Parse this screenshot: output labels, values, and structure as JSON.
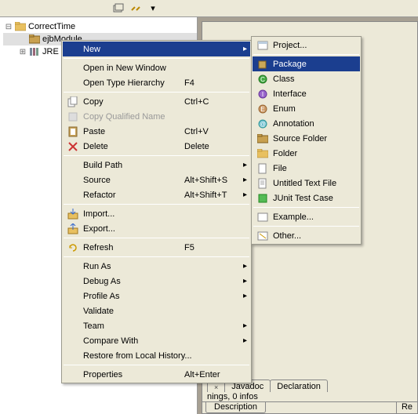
{
  "toolbar": {
    "icons": [
      "collapse-icon",
      "link-icon",
      "menu-icon"
    ]
  },
  "tree": {
    "root": "CorrectTime",
    "child1": "ejbModule",
    "child2": "JRE"
  },
  "context_menu": {
    "new": "New",
    "open_new_window": "Open in New Window",
    "open_type_hierarchy": "Open Type Hierarchy",
    "open_type_hierarchy_key": "F4",
    "copy": "Copy",
    "copy_key": "Ctrl+C",
    "copy_qualified": "Copy Qualified Name",
    "paste": "Paste",
    "paste_key": "Ctrl+V",
    "delete": "Delete",
    "delete_key": "Delete",
    "build_path": "Build Path",
    "source": "Source",
    "source_key": "Alt+Shift+S",
    "refactor": "Refactor",
    "refactor_key": "Alt+Shift+T",
    "import": "Import...",
    "export": "Export...",
    "refresh": "Refresh",
    "refresh_key": "F5",
    "run_as": "Run As",
    "debug_as": "Debug As",
    "profile_as": "Profile As",
    "validate": "Validate",
    "team": "Team",
    "compare_with": "Compare With",
    "restore_history": "Restore from Local History...",
    "properties": "Properties",
    "properties_key": "Alt+Enter"
  },
  "new_submenu": {
    "project": "Project...",
    "package": "Package",
    "class": "Class",
    "interface": "Interface",
    "enum": "Enum",
    "annotation": "Annotation",
    "source_folder": "Source Folder",
    "folder": "Folder",
    "file": "File",
    "untitled_text": "Untitled Text File",
    "junit": "JUnit Test Case",
    "example": "Example...",
    "other": "Other..."
  },
  "bottom": {
    "tab_x": "×",
    "tab_javadoc": "Javadoc",
    "tab_declaration": "Declaration",
    "status_text": "nings, 0 infos",
    "description": "Description",
    "right_col": "Re"
  }
}
